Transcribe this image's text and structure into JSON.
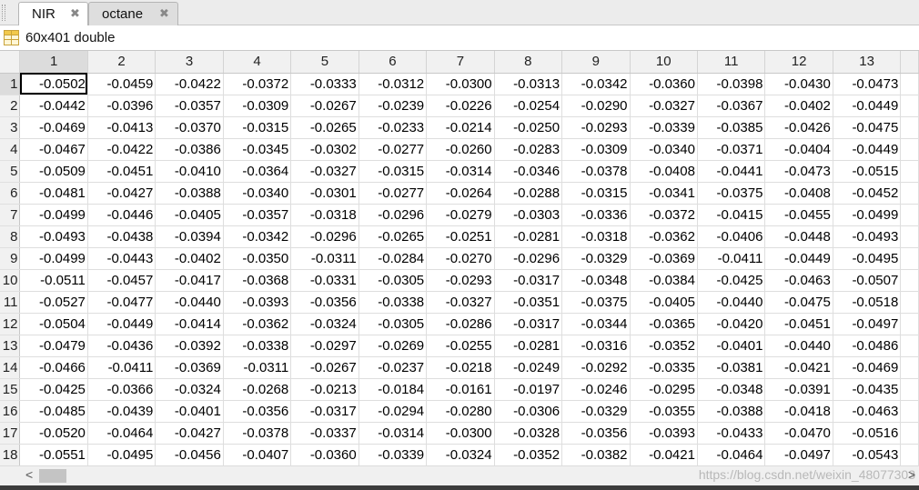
{
  "tabs": [
    {
      "label": "NIR",
      "active": true
    },
    {
      "label": "octane",
      "active": false
    }
  ],
  "close_glyph": "✖",
  "variable_info": "60x401 double",
  "columns": [
    "1",
    "2",
    "3",
    "4",
    "5",
    "6",
    "7",
    "8",
    "9",
    "10",
    "11",
    "12",
    "13"
  ],
  "rows": [
    {
      "index": "1",
      "values": [
        "-0.0502",
        "-0.0459",
        "-0.0422",
        "-0.0372",
        "-0.0333",
        "-0.0312",
        "-0.0300",
        "-0.0313",
        "-0.0342",
        "-0.0360",
        "-0.0398",
        "-0.0430",
        "-0.0473"
      ]
    },
    {
      "index": "2",
      "values": [
        "-0.0442",
        "-0.0396",
        "-0.0357",
        "-0.0309",
        "-0.0267",
        "-0.0239",
        "-0.0226",
        "-0.0254",
        "-0.0290",
        "-0.0327",
        "-0.0367",
        "-0.0402",
        "-0.0449"
      ]
    },
    {
      "index": "3",
      "values": [
        "-0.0469",
        "-0.0413",
        "-0.0370",
        "-0.0315",
        "-0.0265",
        "-0.0233",
        "-0.0214",
        "-0.0250",
        "-0.0293",
        "-0.0339",
        "-0.0385",
        "-0.0426",
        "-0.0475"
      ]
    },
    {
      "index": "4",
      "values": [
        "-0.0467",
        "-0.0422",
        "-0.0386",
        "-0.0345",
        "-0.0302",
        "-0.0277",
        "-0.0260",
        "-0.0283",
        "-0.0309",
        "-0.0340",
        "-0.0371",
        "-0.0404",
        "-0.0449"
      ]
    },
    {
      "index": "5",
      "values": [
        "-0.0509",
        "-0.0451",
        "-0.0410",
        "-0.0364",
        "-0.0327",
        "-0.0315",
        "-0.0314",
        "-0.0346",
        "-0.0378",
        "-0.0408",
        "-0.0441",
        "-0.0473",
        "-0.0515"
      ]
    },
    {
      "index": "6",
      "values": [
        "-0.0481",
        "-0.0427",
        "-0.0388",
        "-0.0340",
        "-0.0301",
        "-0.0277",
        "-0.0264",
        "-0.0288",
        "-0.0315",
        "-0.0341",
        "-0.0375",
        "-0.0408",
        "-0.0452"
      ]
    },
    {
      "index": "7",
      "values": [
        "-0.0499",
        "-0.0446",
        "-0.0405",
        "-0.0357",
        "-0.0318",
        "-0.0296",
        "-0.0279",
        "-0.0303",
        "-0.0336",
        "-0.0372",
        "-0.0415",
        "-0.0455",
        "-0.0499"
      ]
    },
    {
      "index": "8",
      "values": [
        "-0.0493",
        "-0.0438",
        "-0.0394",
        "-0.0342",
        "-0.0296",
        "-0.0265",
        "-0.0251",
        "-0.0281",
        "-0.0318",
        "-0.0362",
        "-0.0406",
        "-0.0448",
        "-0.0493"
      ]
    },
    {
      "index": "9",
      "values": [
        "-0.0499",
        "-0.0443",
        "-0.0402",
        "-0.0350",
        "-0.0311",
        "-0.0284",
        "-0.0270",
        "-0.0296",
        "-0.0329",
        "-0.0369",
        "-0.0411",
        "-0.0449",
        "-0.0495"
      ]
    },
    {
      "index": "10",
      "values": [
        "-0.0511",
        "-0.0457",
        "-0.0417",
        "-0.0368",
        "-0.0331",
        "-0.0305",
        "-0.0293",
        "-0.0317",
        "-0.0348",
        "-0.0384",
        "-0.0425",
        "-0.0463",
        "-0.0507"
      ]
    },
    {
      "index": "11",
      "values": [
        "-0.0527",
        "-0.0477",
        "-0.0440",
        "-0.0393",
        "-0.0356",
        "-0.0338",
        "-0.0327",
        "-0.0351",
        "-0.0375",
        "-0.0405",
        "-0.0440",
        "-0.0475",
        "-0.0518"
      ]
    },
    {
      "index": "12",
      "values": [
        "-0.0504",
        "-0.0449",
        "-0.0414",
        "-0.0362",
        "-0.0324",
        "-0.0305",
        "-0.0286",
        "-0.0317",
        "-0.0344",
        "-0.0365",
        "-0.0420",
        "-0.0451",
        "-0.0497"
      ]
    },
    {
      "index": "13",
      "values": [
        "-0.0479",
        "-0.0436",
        "-0.0392",
        "-0.0338",
        "-0.0297",
        "-0.0269",
        "-0.0255",
        "-0.0281",
        "-0.0316",
        "-0.0352",
        "-0.0401",
        "-0.0440",
        "-0.0486"
      ]
    },
    {
      "index": "14",
      "values": [
        "-0.0466",
        "-0.0411",
        "-0.0369",
        "-0.0311",
        "-0.0267",
        "-0.0237",
        "-0.0218",
        "-0.0249",
        "-0.0292",
        "-0.0335",
        "-0.0381",
        "-0.0421",
        "-0.0469"
      ]
    },
    {
      "index": "15",
      "values": [
        "-0.0425",
        "-0.0366",
        "-0.0324",
        "-0.0268",
        "-0.0213",
        "-0.0184",
        "-0.0161",
        "-0.0197",
        "-0.0246",
        "-0.0295",
        "-0.0348",
        "-0.0391",
        "-0.0435"
      ]
    },
    {
      "index": "16",
      "values": [
        "-0.0485",
        "-0.0439",
        "-0.0401",
        "-0.0356",
        "-0.0317",
        "-0.0294",
        "-0.0280",
        "-0.0306",
        "-0.0329",
        "-0.0355",
        "-0.0388",
        "-0.0418",
        "-0.0463"
      ]
    },
    {
      "index": "17",
      "values": [
        "-0.0520",
        "-0.0464",
        "-0.0427",
        "-0.0378",
        "-0.0337",
        "-0.0314",
        "-0.0300",
        "-0.0328",
        "-0.0356",
        "-0.0393",
        "-0.0433",
        "-0.0470",
        "-0.0516"
      ]
    },
    {
      "index": "18",
      "values": [
        "-0.0551",
        "-0.0495",
        "-0.0456",
        "-0.0407",
        "-0.0360",
        "-0.0339",
        "-0.0324",
        "-0.0352",
        "-0.0382",
        "-0.0421",
        "-0.0464",
        "-0.0497",
        "-0.0543"
      ]
    }
  ],
  "scroll_left_glyph": "<",
  "scroll_right_glyph": ">",
  "watermark": "https://blog.csdn.net/weixin_48077303",
  "icons": {
    "variable": "table-grid-icon",
    "close": "close-icon"
  },
  "colors": {
    "header_bg": "#f1f1f1",
    "grid_line": "#dedede",
    "tab_active": "#ffffff",
    "tab_inactive": "#dedede"
  }
}
